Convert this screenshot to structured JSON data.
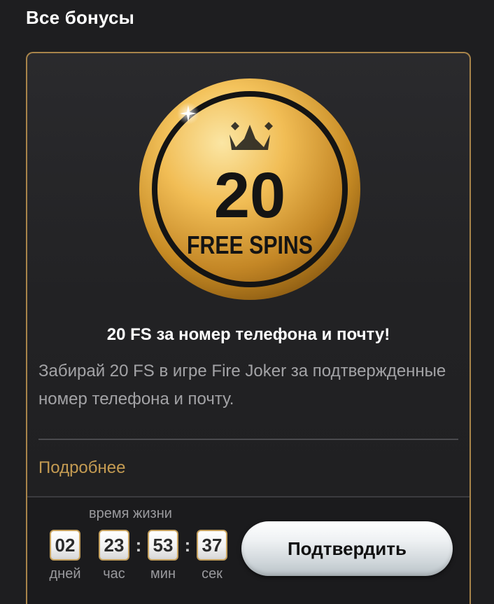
{
  "header": {
    "title": "Все бонусы"
  },
  "bonus_card": {
    "coin": {
      "amount": "20",
      "label": "FREE SPINS",
      "icon": "crown-icon",
      "colors": {
        "gold_light": "#f6cc6a",
        "gold_dark": "#b47e1e",
        "ring": "#1a1a1a"
      }
    },
    "title": "20 FS за номер телефона и почту!",
    "description": "Забирай 20 FS в игре Fire Joker за подтвержденные номер телефона и почту.",
    "more_link": "Подробнее",
    "timer": {
      "caption": "время жизни",
      "days": "02",
      "hours": "23",
      "minutes": "53",
      "seconds": "37",
      "days_label": "дней",
      "hours_label": "час",
      "minutes_label": "мин",
      "seconds_label": "сек",
      "separator": ":"
    },
    "confirm_button": "Подтвердить",
    "accent_color": "#c49b52"
  }
}
